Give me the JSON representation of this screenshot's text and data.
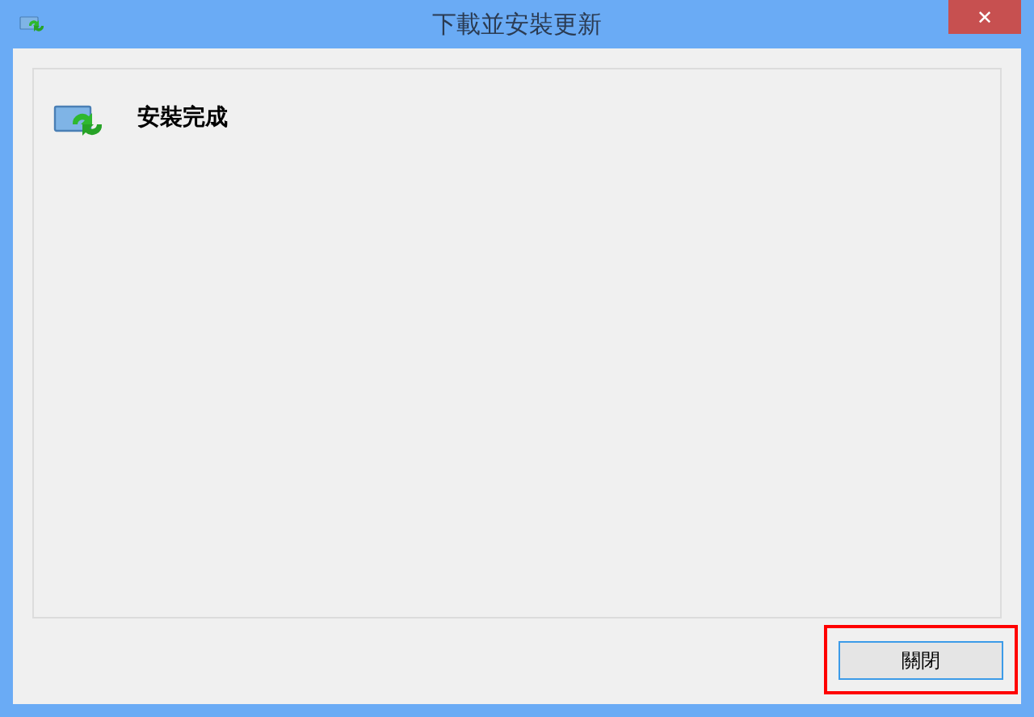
{
  "window": {
    "title": "下載並安裝更新",
    "close": "✕"
  },
  "status": {
    "message": "安裝完成"
  },
  "buttons": [
    {
      "label": "關閉",
      "focused": true,
      "highlighted": true
    }
  ]
}
